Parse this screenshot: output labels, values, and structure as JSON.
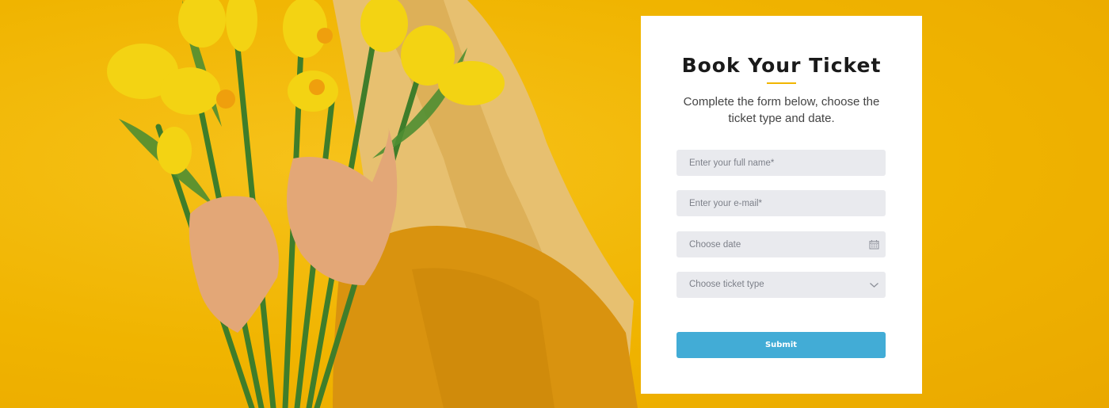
{
  "booking_form": {
    "title": "Book Your Ticket",
    "description": "Complete the form below, choose the ticket type and date.",
    "fields": {
      "full_name_placeholder": "Enter your full name*",
      "email_placeholder": "Enter your e-mail*",
      "date_placeholder": "Choose date",
      "ticket_type_placeholder": "Choose ticket type"
    },
    "icons": {
      "date": "calendar-icon",
      "ticket_type": "chevron-down-icon"
    },
    "submit_label": "Submit"
  },
  "colors": {
    "background": "#f1b500",
    "accent": "#f1b500",
    "button": "#42acd6",
    "field": "#e9eaee"
  }
}
